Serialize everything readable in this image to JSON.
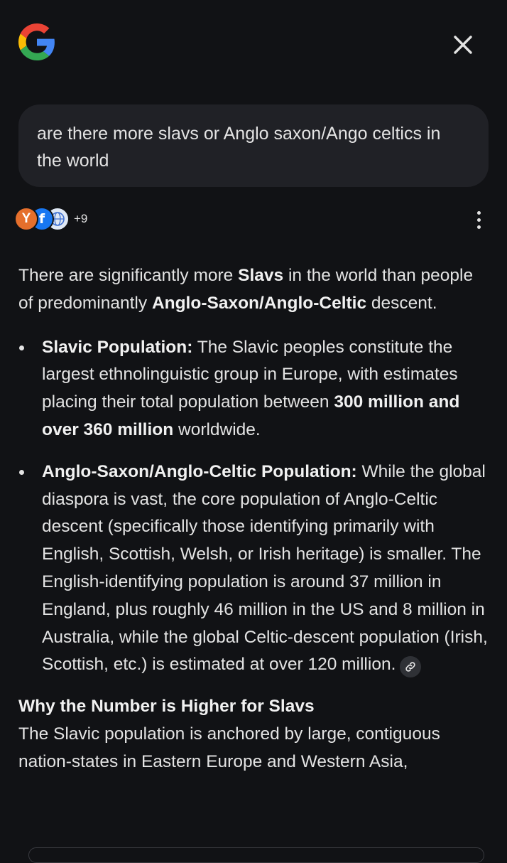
{
  "header": {
    "logo_icon": "google-g-logo",
    "close_icon": "close-icon"
  },
  "query": {
    "text": "are there more slavs or Anglo saxon/Ango celtics in the world"
  },
  "sources": {
    "icons": [
      "y-source-icon",
      "facebook-icon",
      "globe-source-icon"
    ],
    "more_count": "+9",
    "menu_icon": "more-vert-icon"
  },
  "answer": {
    "intro": {
      "t1": "There are significantly more ",
      "b1": "Slavs",
      "t2": " in the world than people of predominantly ",
      "b2": "Anglo-Saxon/Anglo-Celtic",
      "t3": " descent."
    },
    "bullets": [
      {
        "label": "Slavic Population:",
        "t1": " The Slavic peoples constitute the largest ethnolinguistic group in Europe, with estimates placing their total population between ",
        "b1": "300 million and over 360 million",
        "t2": " worldwide."
      },
      {
        "label": "Anglo-Saxon/Anglo-Celtic Population:",
        "t1": " While the global diaspora is vast, the core population of Anglo-Celtic descent (specifically those identifying primarily with English, Scottish, Welsh, or Irish heritage) is smaller. The English-identifying population is around 37 million in England, plus roughly 46 million in the US and 8 million in Australia, while the global Celtic-descent population (Irish, Scottish, etc.) is estimated at over 120 million."
      }
    ],
    "section_heading": "Why the Number is Higher for Slavs",
    "section_text": "The Slavic population is anchored by large, contiguous nation-states in Eastern Europe and Western Asia,"
  },
  "colors": {
    "background": "#111215",
    "bubble": "#202126",
    "text": "#e3e3e3"
  }
}
